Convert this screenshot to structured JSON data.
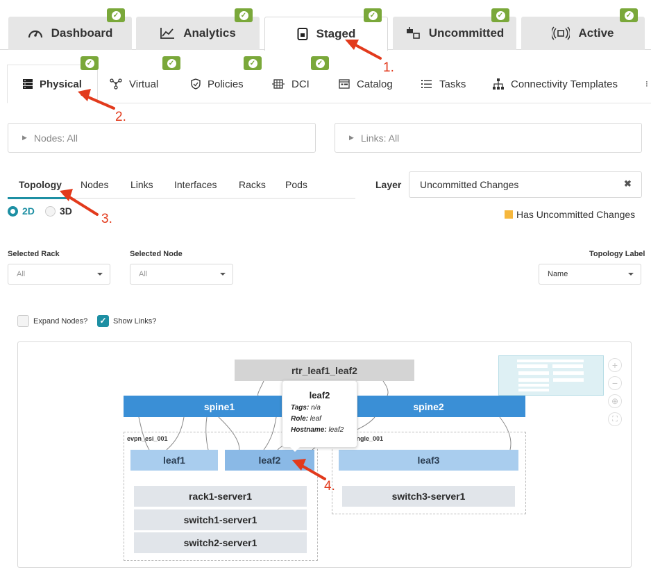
{
  "top_tabs": [
    {
      "label": "Dashboard",
      "icon": "dashboard-gauge-icon"
    },
    {
      "label": "Analytics",
      "icon": "analytics-chart-icon"
    },
    {
      "label": "Staged",
      "icon": "staged-doc-icon",
      "active": true
    },
    {
      "label": "Uncommitted",
      "icon": "uncommitted-icon"
    },
    {
      "label": "Active",
      "icon": "active-broadcast-icon"
    }
  ],
  "secondary_tabs": [
    {
      "label": "Physical",
      "icon": "server-stack-icon",
      "active": true
    },
    {
      "label": "Virtual",
      "icon": "virtual-network-icon"
    },
    {
      "label": "Policies",
      "icon": "shield-icon"
    },
    {
      "label": "DCI",
      "icon": "dci-building-icon"
    },
    {
      "label": "Catalog",
      "icon": "catalog-icon"
    },
    {
      "label": "Tasks",
      "icon": "tasks-list-icon"
    },
    {
      "label": "Connectivity Templates",
      "icon": "hierarchy-icon"
    }
  ],
  "filters": {
    "nodes": "Nodes: All",
    "links": "Links: All"
  },
  "sub_tabs": [
    "Topology",
    "Nodes",
    "Links",
    "Interfaces",
    "Racks",
    "Pods"
  ],
  "view_mode": {
    "options": [
      "2D",
      "3D"
    ],
    "selected": "2D"
  },
  "layer": {
    "label": "Layer",
    "value": "Uncommitted Changes",
    "legend": "Has Uncommitted Changes",
    "legend_color": "#f6b73c"
  },
  "selectors": {
    "rack": {
      "label": "Selected Rack",
      "value": "All"
    },
    "node": {
      "label": "Selected Node",
      "value": "All"
    },
    "topology_label": {
      "label": "Topology Label",
      "value": "Name"
    }
  },
  "checkboxes": {
    "expand_nodes": {
      "label": "Expand Nodes?",
      "checked": false
    },
    "show_links": {
      "label": "Show Links?",
      "checked": true
    }
  },
  "topology": {
    "top_node": "rtr_leaf1_leaf2",
    "spines": [
      "spine1",
      "spine2"
    ],
    "racks": [
      {
        "label": "evpn_esi_001",
        "leaves": [
          "leaf1",
          "leaf2"
        ],
        "servers": [
          "rack1-server1",
          "switch1-server1",
          "switch2-server1"
        ]
      },
      {
        "label": "ingle_001",
        "leaves": [
          "leaf3"
        ],
        "servers": [
          "switch3-server1"
        ]
      }
    ],
    "tooltip": {
      "title": "leaf2",
      "tags_label": "Tags:",
      "tags": "n/a",
      "role_label": "Role:",
      "role": "leaf",
      "hostname_label": "Hostname:",
      "hostname": "leaf2"
    }
  },
  "callouts": [
    "1.",
    "2.",
    "3.",
    "4."
  ],
  "colors": {
    "accent": "#1d8fa3",
    "badge": "#7aa83a",
    "spine": "#3a8fd6",
    "leaf": "#a9cdee",
    "arrow": "#e23a1c"
  }
}
